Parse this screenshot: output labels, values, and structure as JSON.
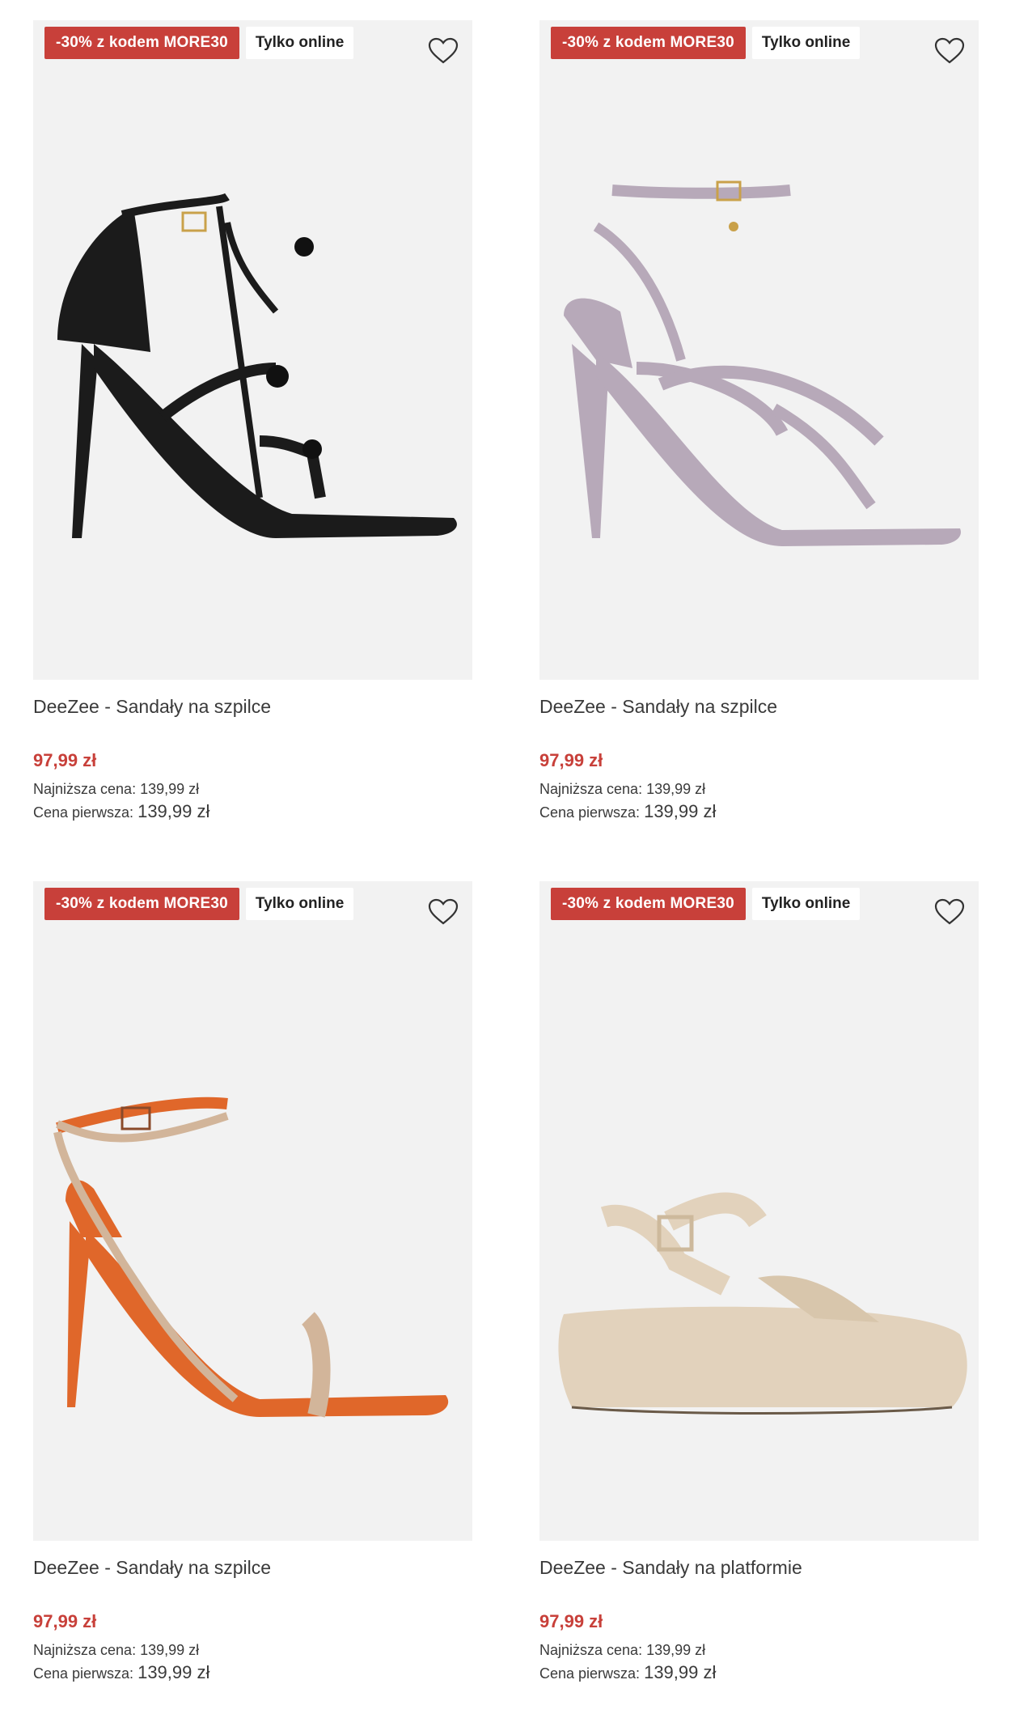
{
  "products": [
    {
      "badge_promo": "-30% z kodem MORE30",
      "badge_online": "Tylko online",
      "name": "DeeZee - Sandały na szpilce",
      "price": "97,99 zł",
      "lowest_label": "Najniższa cena:",
      "lowest_value": "139,99 zł",
      "first_label": "Cena pierwsza:",
      "first_value": "139,99 zł",
      "color": "#1b1b1b"
    },
    {
      "badge_promo": "-30% z kodem MORE30",
      "badge_online": "Tylko online",
      "name": "DeeZee - Sandały na szpilce",
      "price": "97,99 zł",
      "lowest_label": "Najniższa cena:",
      "lowest_value": "139,99 zł",
      "first_label": "Cena pierwsza:",
      "first_value": "139,99 zł",
      "color": "#b7a9b9"
    },
    {
      "badge_promo": "-30% z kodem MORE30",
      "badge_online": "Tylko online",
      "name": "DeeZee - Sandały na szpilce",
      "price": "97,99 zł",
      "lowest_label": "Najniższa cena:",
      "lowest_value": "139,99 zł",
      "first_label": "Cena pierwsza:",
      "first_value": "139,99 zł",
      "color": "#e0672a"
    },
    {
      "badge_promo": "-30% z kodem MORE30",
      "badge_online": "Tylko online",
      "name": "DeeZee - Sandały na platformie",
      "price": "97,99 zł",
      "lowest_label": "Najniższa cena:",
      "lowest_value": "139,99 zł",
      "first_label": "Cena pierwsza:",
      "first_value": "139,99 zł",
      "color": "#e2d2bc"
    }
  ],
  "icons": {
    "favorite": "heart-outline-icon"
  },
  "colors": {
    "promo": "#c8403a",
    "image_bg": "#f2f2f2"
  }
}
